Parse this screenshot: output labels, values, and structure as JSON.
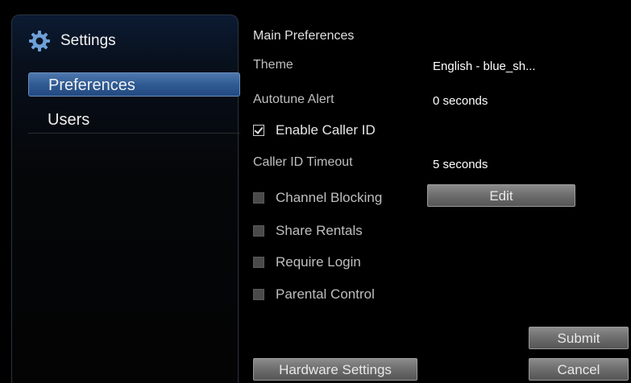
{
  "sidebar": {
    "title": "Settings",
    "icon": "gear-icon",
    "items": [
      {
        "label": "Preferences",
        "active": true
      },
      {
        "label": "Users",
        "active": false
      }
    ]
  },
  "main": {
    "section_title": "Main Preferences",
    "theme": {
      "label": "Theme",
      "value": "English - blue_sh..."
    },
    "autotune": {
      "label": "Autotune Alert",
      "value": "0 seconds"
    },
    "caller_id": {
      "label": "Enable Caller ID",
      "checked": true
    },
    "caller_timeout": {
      "label": "Caller ID Timeout",
      "value": "5 seconds"
    },
    "channel_blocking": {
      "label": "Channel Blocking",
      "checked": false,
      "button": "Edit"
    },
    "share_rentals": {
      "label": "Share Rentals",
      "checked": false
    },
    "require_login": {
      "label": "Require Login",
      "checked": false
    },
    "parental_control": {
      "label": "Parental Control",
      "checked": false
    }
  },
  "buttons": {
    "submit": "Submit",
    "cancel": "Cancel",
    "hardware": "Hardware Settings"
  },
  "colors": {
    "background": "#000000",
    "active_item": "#3a6398",
    "button": "#707070"
  }
}
